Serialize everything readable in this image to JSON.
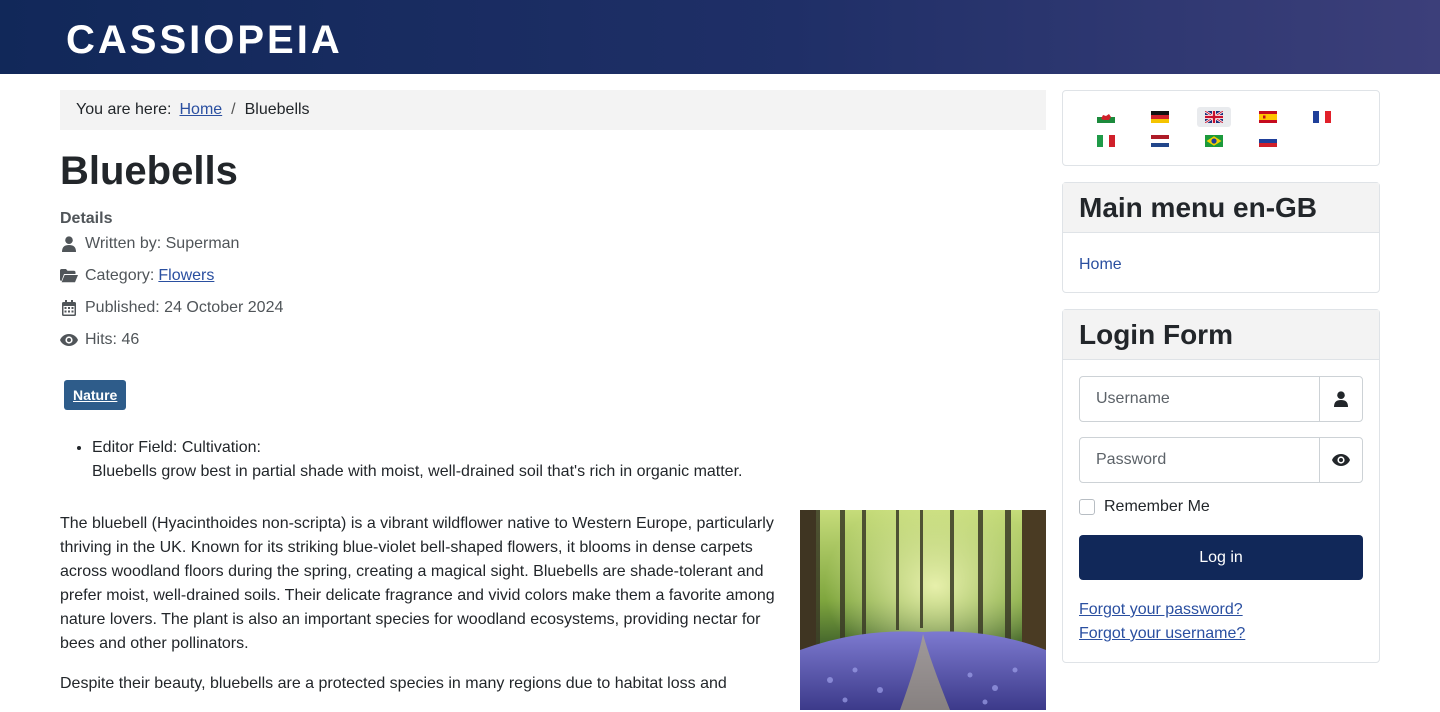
{
  "header": {
    "brand": "CASSIOPEIA"
  },
  "breadcrumb": {
    "prefix": "You are here:",
    "home": "Home",
    "separator": "/",
    "current": "Bluebells"
  },
  "article": {
    "title": "Bluebells",
    "details_heading": "Details",
    "written_by": "Written by: Superman",
    "category_label": "Category:",
    "category_link": "Flowers",
    "published": "Published: 24 October 2024",
    "hits": "Hits: 46",
    "tag": "Nature",
    "field_label": "Editor Field: Cultivation:",
    "field_value": "Bluebells grow best in partial shade with moist, well-drained soil that's rich in organic matter.",
    "paragraph1": "The bluebell (Hyacinthoides non-scripta) is a vibrant wildflower native to Western Europe, particularly thriving in the UK. Known for its striking blue-violet bell-shaped flowers, it blooms in dense carpets across woodland floors during the spring, creating a magical sight. Bluebells are shade-tolerant and prefer moist, well-drained soils. Their delicate fragrance and vivid colors make them a favorite among nature lovers. The plant is also an important species for woodland ecosystems, providing nectar for bees and other pollinators.",
    "paragraph2": "Despite their beauty, bluebells are a protected species in many regions due to habitat loss and"
  },
  "languages": [
    {
      "code": "cy",
      "icon": "wales-flag-icon",
      "active": false
    },
    {
      "code": "de",
      "icon": "germany-flag-icon",
      "active": false
    },
    {
      "code": "en-GB",
      "icon": "uk-flag-icon",
      "active": true
    },
    {
      "code": "es",
      "icon": "spain-flag-icon",
      "active": false
    },
    {
      "code": "fr",
      "icon": "france-flag-icon",
      "active": false
    },
    {
      "code": "it",
      "icon": "italy-flag-icon",
      "active": false
    },
    {
      "code": "nl",
      "icon": "netherlands-flag-icon",
      "active": false
    },
    {
      "code": "pt-BR",
      "icon": "brazil-flag-icon",
      "active": false
    },
    {
      "code": "ru",
      "icon": "russia-flag-icon",
      "active": false
    }
  ],
  "main_menu": {
    "title": "Main menu en-GB",
    "items": [
      {
        "label": "Home"
      }
    ]
  },
  "login": {
    "title": "Login Form",
    "username_placeholder": "Username",
    "password_placeholder": "Password",
    "remember": "Remember Me",
    "submit": "Log in",
    "forgot_password": "Forgot your password?",
    "forgot_username": "Forgot your username?"
  },
  "colors": {
    "header_start": "#112859",
    "header_end": "#3c3f7a",
    "link": "#2a4fa0",
    "tag": "#2e5c8a",
    "button": "#112859"
  }
}
